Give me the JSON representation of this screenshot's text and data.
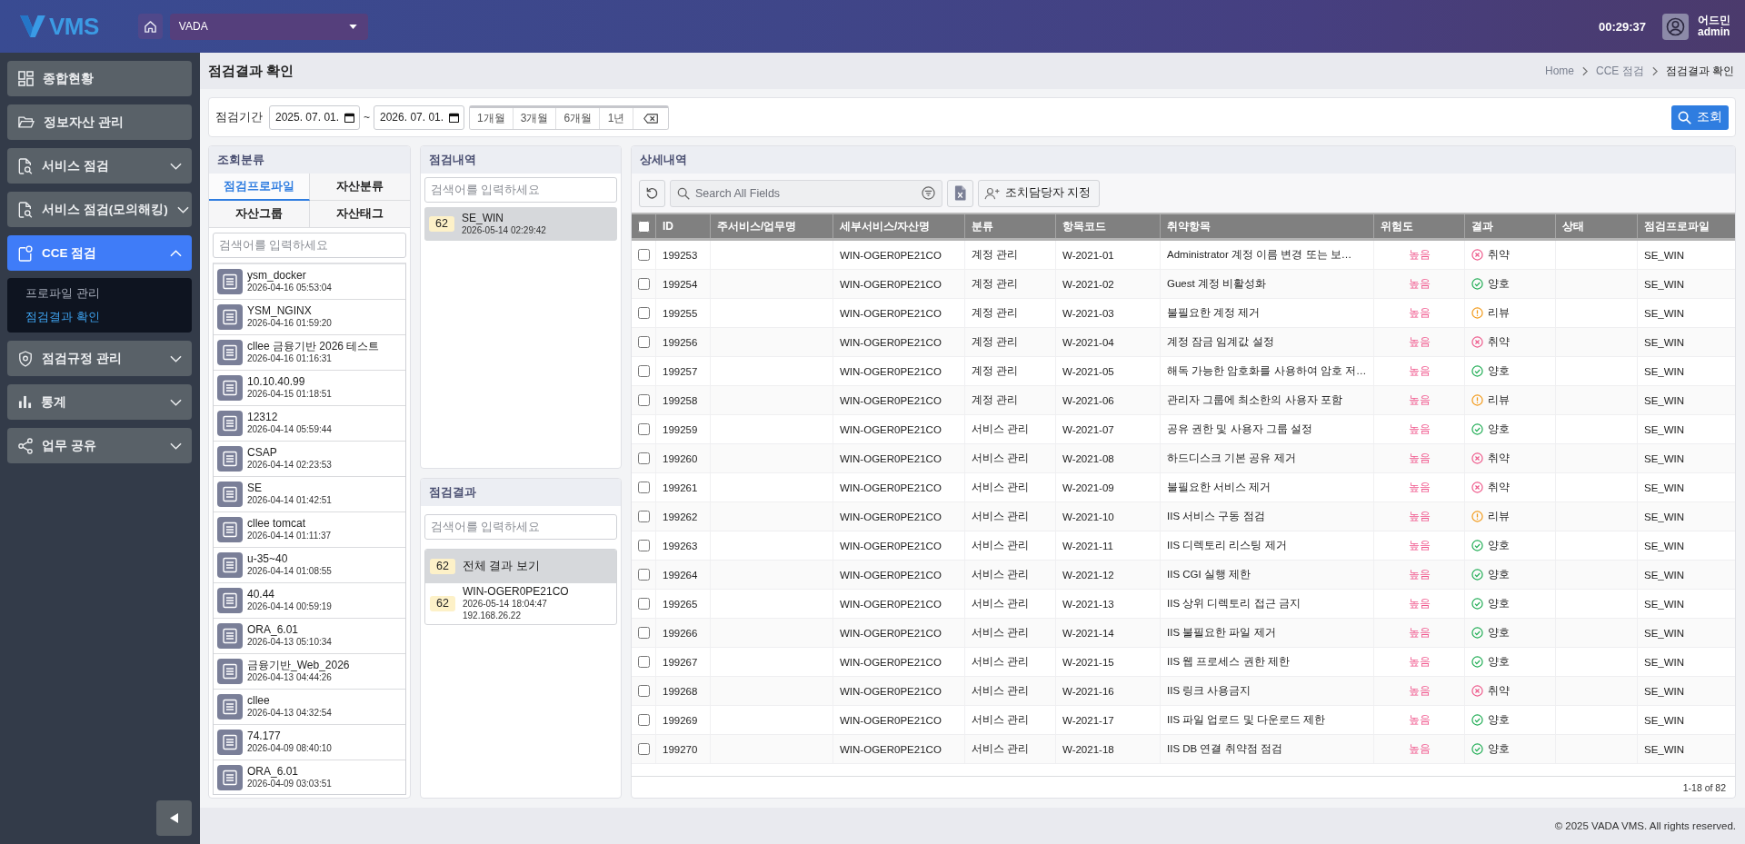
{
  "header": {
    "logo": "VMS",
    "site_select": "VADA",
    "clock": "00:29:37",
    "user": {
      "name": "어드민",
      "id": "admin"
    }
  },
  "sidebar": {
    "items": [
      {
        "label": "종합현황",
        "kind": "link",
        "selected": false
      },
      {
        "label": "정보자산 관리",
        "kind": "link",
        "selected": false
      },
      {
        "label": "서비스 점검",
        "kind": "group",
        "selected": false,
        "expanded": false
      },
      {
        "label": "서비스 점검(모의해킹)",
        "kind": "group",
        "selected": false,
        "expanded": false
      },
      {
        "label": "CCE 점검",
        "kind": "group",
        "selected": true,
        "expanded": true,
        "children": [
          {
            "label": "프로파일 관리",
            "selected": false
          },
          {
            "label": "점검결과 확인",
            "selected": true
          }
        ]
      },
      {
        "label": "점검규정 관리",
        "kind": "group",
        "selected": false,
        "expanded": false
      },
      {
        "label": "통계",
        "kind": "group",
        "selected": false,
        "expanded": false
      },
      {
        "label": "업무 공유",
        "kind": "group",
        "selected": false,
        "expanded": false
      }
    ]
  },
  "page": {
    "title": "점검결과 확인",
    "breadcrumb": [
      "Home",
      "CCE 점검",
      "점검결과 확인"
    ]
  },
  "filter": {
    "label": "점검기간",
    "start_date": "2025. 07. 01.",
    "separator": "~",
    "end_date": "2026. 07. 01.",
    "ranges": [
      {
        "label": "1개월",
        "selected": false
      },
      {
        "label": "3개월",
        "selected": false
      },
      {
        "label": "6개월",
        "selected": false
      },
      {
        "label": "1년",
        "selected": false
      }
    ],
    "search_button": "조회"
  },
  "category_panel": {
    "title": "조회분류",
    "tabs": [
      {
        "label": "점검프로파일",
        "selected": true
      },
      {
        "label": "자산분류",
        "selected": false
      },
      {
        "label": "자산그룹",
        "selected": false
      },
      {
        "label": "자산태그",
        "selected": false
      }
    ],
    "search": {
      "placeholder": "검색어를 입력하세요"
    },
    "profiles": [
      {
        "name": "ysm_docker",
        "date": "2026-04-16 05:53:04",
        "selected": false
      },
      {
        "name": "YSM_NGINX",
        "date": "2026-04-16 01:59:20",
        "selected": false
      },
      {
        "name": "cllee 금융기반 2026 테스트",
        "date": "2026-04-16 01:16:31",
        "selected": false
      },
      {
        "name": "10.10.40.99",
        "date": "2026-04-15 01:18:51",
        "selected": false
      },
      {
        "name": "12312",
        "date": "2026-04-14 05:59:44",
        "selected": false
      },
      {
        "name": "CSAP",
        "date": "2026-04-14 02:23:53",
        "selected": false
      },
      {
        "name": "SE",
        "date": "2026-04-14 01:42:51",
        "selected": false
      },
      {
        "name": "cllee tomcat",
        "date": "2026-04-14 01:11:37",
        "selected": false
      },
      {
        "name": "u-35~40",
        "date": "2026-04-14 01:08:55",
        "selected": false
      },
      {
        "name": "40.44",
        "date": "2026-04-14 00:59:19",
        "selected": false
      },
      {
        "name": "ORA_6.01",
        "date": "2026-04-13 05:10:34",
        "selected": false
      },
      {
        "name": "금융기반_Web_2026",
        "date": "2026-04-13 04:44:26",
        "selected": false
      },
      {
        "name": "cllee",
        "date": "2026-04-13 04:32:54",
        "selected": false
      },
      {
        "name": "74.177",
        "date": "2026-04-09 08:40:10",
        "selected": false
      },
      {
        "name": "ORA_6.01",
        "date": "2026-04-09 03:03:51",
        "selected": false
      }
    ]
  },
  "history_panel": {
    "title": "점검내역",
    "search": {
      "placeholder": "검색어를 입력하세요"
    },
    "items": [
      {
        "count": "62",
        "name": "SE_WIN",
        "date": "2026-05-14 02:29:42",
        "selected": true
      }
    ]
  },
  "result_panel": {
    "title": "점검결과",
    "search": {
      "placeholder": "검색어를 입력하세요"
    },
    "items": [
      {
        "kind": "summary",
        "count": "62",
        "label": "전체 결과 보기",
        "selected": true
      },
      {
        "kind": "asset",
        "count": "62",
        "name": "WIN-OGER0PE21CO",
        "date": "2026-05-14 18:04:47",
        "ip": "192.168.26.22",
        "selected": false
      }
    ]
  },
  "detail_panel": {
    "title": "상세내역",
    "search": {
      "placeholder": "Search All Fields"
    },
    "assign_button": "조치담당자 지정",
    "table": {
      "select_all": false,
      "columns": [
        "ID",
        "주서비스/업무명",
        "세부서비스/자산명",
        "분류",
        "항목코드",
        "취약항목",
        "위험도",
        "결과",
        "상태",
        "점검프로파일"
      ],
      "rows": [
        {
          "checked": false,
          "id": "199253",
          "asset": "WIN-OGER0PE21CO",
          "category": "계정 관리",
          "code": "W-2021-01",
          "item": "Administrator 계정 이름 변경 또는 보…",
          "risk": "높음",
          "result": {
            "text": "취약",
            "kind": "fail"
          },
          "profile": "SE_WIN"
        },
        {
          "checked": false,
          "id": "199254",
          "asset": "WIN-OGER0PE21CO",
          "category": "계정 관리",
          "code": "W-2021-02",
          "item": "Guest 계정 비활성화",
          "risk": "높음",
          "result": {
            "text": "양호",
            "kind": "pass"
          },
          "profile": "SE_WIN"
        },
        {
          "checked": false,
          "id": "199255",
          "asset": "WIN-OGER0PE21CO",
          "category": "계정 관리",
          "code": "W-2021-03",
          "item": "불필요한 계정 제거",
          "risk": "높음",
          "result": {
            "text": "리뷰",
            "kind": "review"
          },
          "profile": "SE_WIN"
        },
        {
          "checked": false,
          "id": "199256",
          "asset": "WIN-OGER0PE21CO",
          "category": "계정 관리",
          "code": "W-2021-04",
          "item": "계정 잠금 임계값 설정",
          "risk": "높음",
          "result": {
            "text": "취약",
            "kind": "fail"
          },
          "profile": "SE_WIN"
        },
        {
          "checked": false,
          "id": "199257",
          "asset": "WIN-OGER0PE21CO",
          "category": "계정 관리",
          "code": "W-2021-05",
          "item": "해독 가능한 암호화를 사용하여 암호 저…",
          "risk": "높음",
          "result": {
            "text": "양호",
            "kind": "pass"
          },
          "profile": "SE_WIN"
        },
        {
          "checked": false,
          "id": "199258",
          "asset": "WIN-OGER0PE21CO",
          "category": "계정 관리",
          "code": "W-2021-06",
          "item": "관리자 그룹에 최소한의 사용자 포함",
          "risk": "높음",
          "result": {
            "text": "리뷰",
            "kind": "review"
          },
          "profile": "SE_WIN"
        },
        {
          "checked": false,
          "id": "199259",
          "asset": "WIN-OGER0PE21CO",
          "category": "서비스 관리",
          "code": "W-2021-07",
          "item": "공유 권한 및 사용자 그룹 설정",
          "risk": "높음",
          "result": {
            "text": "양호",
            "kind": "pass"
          },
          "profile": "SE_WIN"
        },
        {
          "checked": false,
          "id": "199260",
          "asset": "WIN-OGER0PE21CO",
          "category": "서비스 관리",
          "code": "W-2021-08",
          "item": "하드디스크 기본 공유 제거",
          "risk": "높음",
          "result": {
            "text": "취약",
            "kind": "fail"
          },
          "profile": "SE_WIN"
        },
        {
          "checked": false,
          "id": "199261",
          "asset": "WIN-OGER0PE21CO",
          "category": "서비스 관리",
          "code": "W-2021-09",
          "item": "불필요한 서비스 제거",
          "risk": "높음",
          "result": {
            "text": "취약",
            "kind": "fail"
          },
          "profile": "SE_WIN"
        },
        {
          "checked": false,
          "id": "199262",
          "asset": "WIN-OGER0PE21CO",
          "category": "서비스 관리",
          "code": "W-2021-10",
          "item": "IIS 서비스 구동 점검",
          "risk": "높음",
          "result": {
            "text": "리뷰",
            "kind": "review"
          },
          "profile": "SE_WIN"
        },
        {
          "checked": false,
          "id": "199263",
          "asset": "WIN-OGER0PE21CO",
          "category": "서비스 관리",
          "code": "W-2021-11",
          "item": "IIS 디렉토리 리스팅 제거",
          "risk": "높음",
          "result": {
            "text": "양호",
            "kind": "pass"
          },
          "profile": "SE_WIN"
        },
        {
          "checked": false,
          "id": "199264",
          "asset": "WIN-OGER0PE21CO",
          "category": "서비스 관리",
          "code": "W-2021-12",
          "item": "IIS CGI 실행 제한",
          "risk": "높음",
          "result": {
            "text": "양호",
            "kind": "pass"
          },
          "profile": "SE_WIN"
        },
        {
          "checked": false,
          "id": "199265",
          "asset": "WIN-OGER0PE21CO",
          "category": "서비스 관리",
          "code": "W-2021-13",
          "item": "IIS 상위 디렉토리 접근 금지",
          "risk": "높음",
          "result": {
            "text": "양호",
            "kind": "pass"
          },
          "profile": "SE_WIN"
        },
        {
          "checked": false,
          "id": "199266",
          "asset": "WIN-OGER0PE21CO",
          "category": "서비스 관리",
          "code": "W-2021-14",
          "item": "IIS 불필요한 파일 제거",
          "risk": "높음",
          "result": {
            "text": "양호",
            "kind": "pass"
          },
          "profile": "SE_WIN"
        },
        {
          "checked": false,
          "id": "199267",
          "asset": "WIN-OGER0PE21CO",
          "category": "서비스 관리",
          "code": "W-2021-15",
          "item": "IIS 웹 프로세스 권한 제한",
          "risk": "높음",
          "result": {
            "text": "양호",
            "kind": "pass"
          },
          "profile": "SE_WIN"
        },
        {
          "checked": false,
          "id": "199268",
          "asset": "WIN-OGER0PE21CO",
          "category": "서비스 관리",
          "code": "W-2021-16",
          "item": "IIS 링크 사용금지",
          "risk": "높음",
          "result": {
            "text": "취약",
            "kind": "fail"
          },
          "profile": "SE_WIN"
        },
        {
          "checked": false,
          "id": "199269",
          "asset": "WIN-OGER0PE21CO",
          "category": "서비스 관리",
          "code": "W-2021-17",
          "item": "IIS 파일 업로드 및 다운로드 제한",
          "risk": "높음",
          "result": {
            "text": "양호",
            "kind": "pass"
          },
          "profile": "SE_WIN"
        },
        {
          "checked": false,
          "id": "199270",
          "asset": "WIN-OGER0PE21CO",
          "category": "서비스 관리",
          "code": "W-2021-18",
          "item": "IIS DB 연결 취약점 점검",
          "risk": "높음",
          "result": {
            "text": "양호",
            "kind": "pass"
          },
          "profile": "SE_WIN"
        }
      ]
    },
    "pagination": "1-18 of 82"
  },
  "footer": "© 2025 VADA VMS. All rights reserved."
}
